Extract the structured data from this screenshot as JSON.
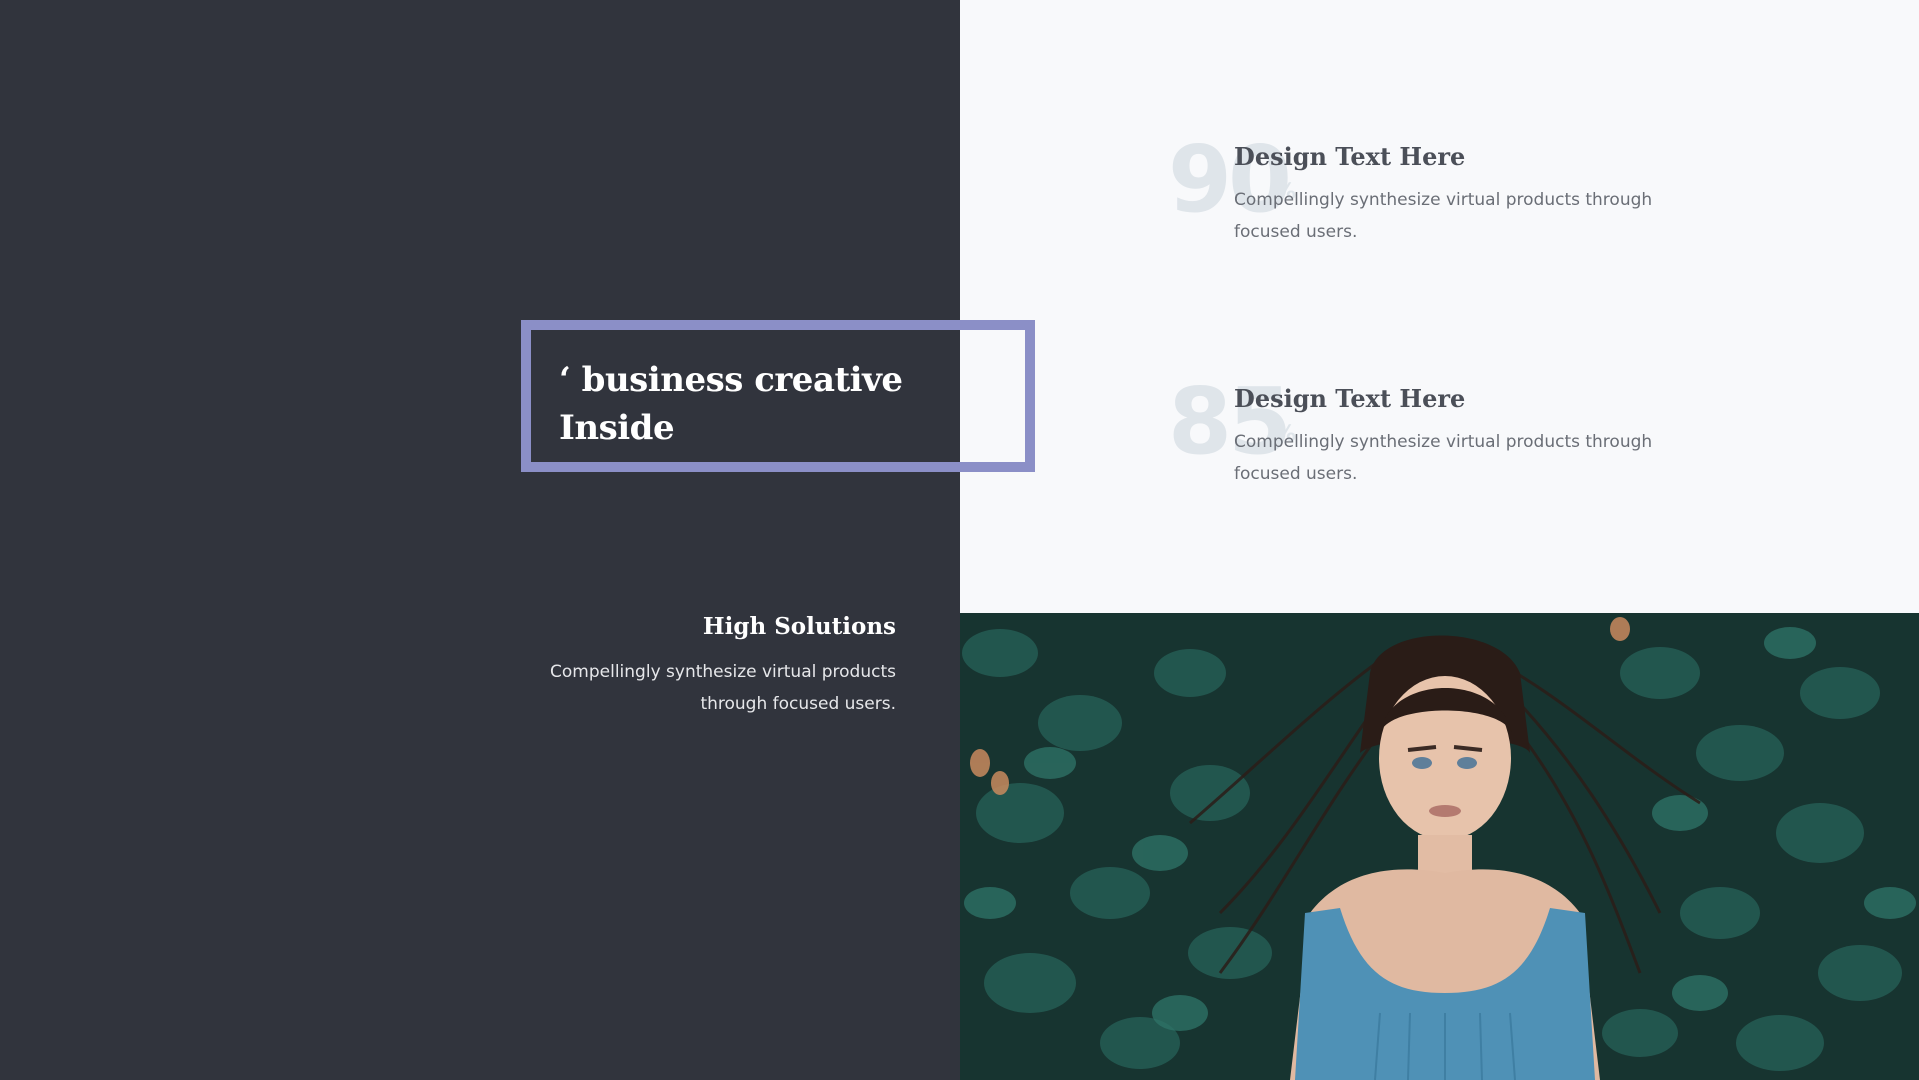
{
  "quote": {
    "text": "‘ business creative Inside"
  },
  "solutions": {
    "title": "High Solutions",
    "description": "Compellingly synthesize virtual products through focused users."
  },
  "stats": [
    {
      "number": "90",
      "unit": "%",
      "title": "Design Text Here",
      "description": "Compellingly synthesize virtual products through focused users."
    },
    {
      "number": "85",
      "unit": "%",
      "title": "Design Text Here",
      "description": "Compellingly synthesize virtual products through focused users."
    }
  ],
  "colors": {
    "dark_panel": "#31343d",
    "accent_frame": "#8b8fc7",
    "light_panel": "#f8f9fb"
  }
}
